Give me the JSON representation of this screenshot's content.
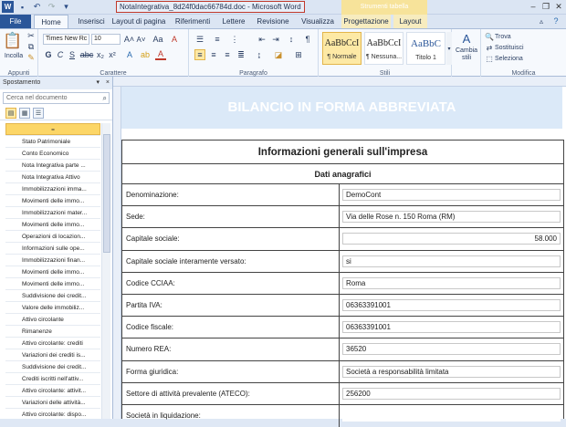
{
  "window": {
    "title": "NotaIntegrativa_8d24f0dac66784d.doc - Microsoft Word",
    "context_tab_group": "Strumenti tabella"
  },
  "tabs": [
    {
      "label": "File"
    },
    {
      "label": "Home"
    },
    {
      "label": "Inserisci"
    },
    {
      "label": "Layout di pagina"
    },
    {
      "label": "Riferimenti"
    },
    {
      "label": "Lettere"
    },
    {
      "label": "Revisione"
    },
    {
      "label": "Visualizza"
    },
    {
      "label": "Progettazione"
    },
    {
      "label": "Layout"
    }
  ],
  "ribbon": {
    "clipboard": {
      "label": "Appunti",
      "paste": "Incolla"
    },
    "font": {
      "label": "Carattere",
      "font_name": "Times New Rc",
      "font_size": "10"
    },
    "paragraph": {
      "label": "Paragrafo"
    },
    "styles": {
      "label": "Stili",
      "items": [
        {
          "preview": "AaBbCcI",
          "name": "¶ Normale"
        },
        {
          "preview": "AaBbCcI",
          "name": "¶ Nessuna..."
        },
        {
          "preview": "AaBbC",
          "name": "Titolo 1"
        }
      ],
      "change": "Cambia stili"
    },
    "editing": {
      "label": "Modifica",
      "find": "Trova",
      "replace": "Sostituisci",
      "select": "Seleziona"
    }
  },
  "nav": {
    "title": "Spostamento",
    "search_placeholder": "Cerca nel documento",
    "selected": "=",
    "items": [
      "Stato Patrimoniale",
      "Conto Economico",
      "Nota Integrativa parte ...",
      "Nota Integrativa Attivo",
      "Immobilizzazioni imma...",
      "Movimenti delle immo...",
      "Immobilizzazioni mater...",
      "Movimenti delle immo...",
      "Operazioni di locazion...",
      "Informazioni sulle ope...",
      "Immobilizzazioni finan...",
      "Movimenti delle immo...",
      "Movimenti delle immo...",
      "Suddivisione dei credit...",
      "Valore delle immobiliz...",
      "Attivo circolante",
      "Rimanenze",
      "Attivo circolante: crediti",
      "Variazioni dei crediti is...",
      "Suddivisione dei credit...",
      "Crediti iscritti nell'attiv...",
      "Attivo circolante: attivit...",
      "Variazioni delle attività...",
      "Attivo circolante: dispo..."
    ]
  },
  "document": {
    "banner": "BILANCIO IN FORMA ABBREVIATA",
    "section_title": "Informazioni generali sull'impresa",
    "subsection_title": "Dati anagrafici",
    "rows": [
      {
        "label": "Denominazione:",
        "value": "DemoCont"
      },
      {
        "label": "Sede:",
        "value": "Via delle Rose n. 150 Roma (RM)"
      },
      {
        "label": "Capitale sociale:",
        "value": "58.000"
      },
      {
        "label": "Capitale sociale interamente versato:",
        "value": "si"
      },
      {
        "label": "Codice CCIAA:",
        "value": "Roma"
      },
      {
        "label": "Partita IVA:",
        "value": "06363391001"
      },
      {
        "label": "Codice fiscale:",
        "value": "06363391001"
      },
      {
        "label": "Numero REA:",
        "value": "36520"
      },
      {
        "label": "Forma giuridica:",
        "value": "Società a responsabilità limitata"
      },
      {
        "label": "Settore di attività prevalente (ATECO):",
        "value": "256200"
      },
      {
        "label": "Società in liquidazione:",
        "value": ""
      }
    ]
  }
}
